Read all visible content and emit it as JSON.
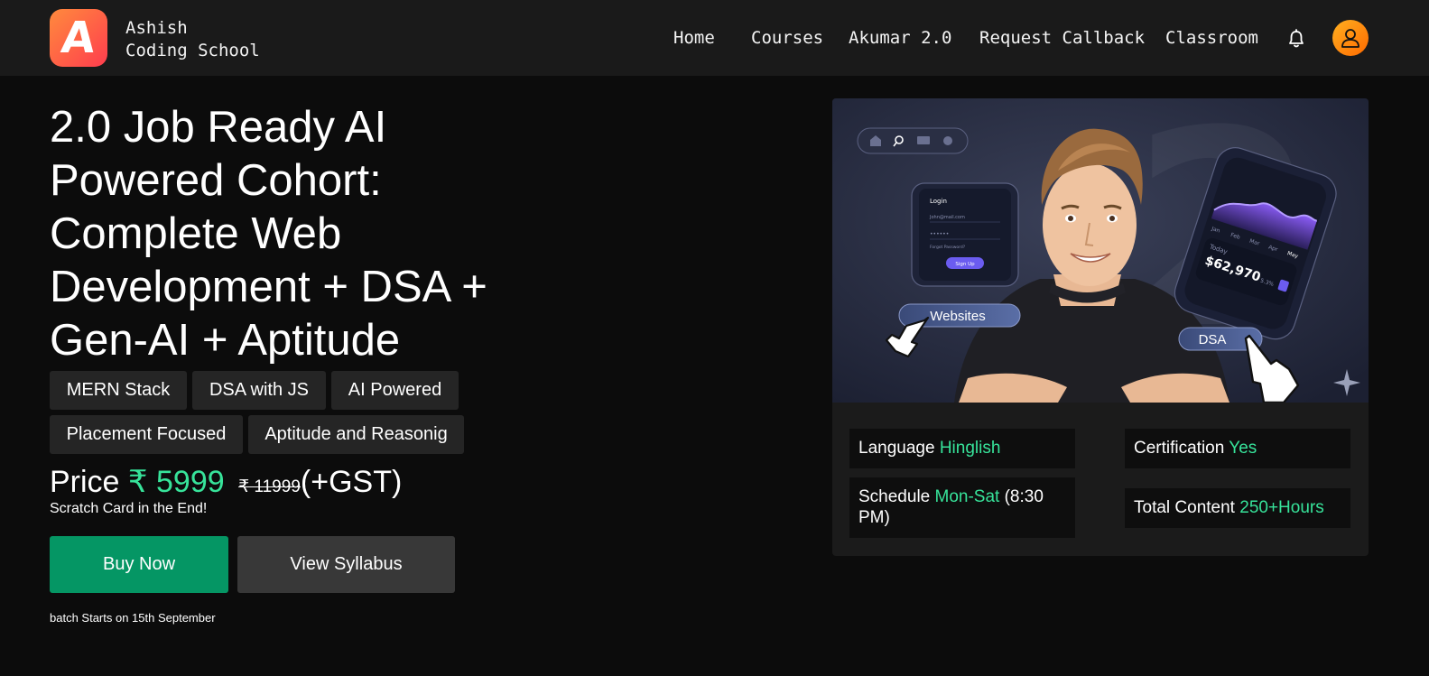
{
  "nav": {
    "logo_letter": "A",
    "brand_line1": "Ashish",
    "brand_line2": "Coding School",
    "links": [
      "Home",
      "Courses",
      "Akumar 2.0",
      "Request Callback",
      "Classroom"
    ],
    "bell_icon": "bell-icon",
    "avatar_icon": "user-icon"
  },
  "hero": {
    "title": "2.0 Job Ready AI Powered Cohort: Complete Web Development + DSA + Gen-AI + Aptitude",
    "tags": [
      "MERN Stack",
      "DSA with JS",
      "AI Powered",
      "Placement Focused",
      "Aptitude and Reasonig"
    ],
    "price_label": "Price",
    "price_now": "₹ 5999",
    "price_old": "₹ 11999",
    "price_gst": "(+GST)",
    "scratch_note": "Scratch Card in the End!",
    "buy_label": "Buy Now",
    "syllabus_label": "View Syllabus",
    "batch_note": "batch Starts on 15th September"
  },
  "banner": {
    "login_title": "Login",
    "login_email_placeholder": "John@mail.com",
    "login_password_mask": "••••••",
    "login_forgot": "Forgot Password?",
    "login_button": "Sign Up",
    "websites_label": "Websites",
    "dsa_label": "DSA",
    "dash_months": [
      "Jan",
      "Feb",
      "Mar",
      "Apr",
      "May"
    ],
    "dash_today": "Today",
    "dash_amount": "$62,970",
    "dash_percent": "5.3%"
  },
  "details": {
    "language_label": "Language",
    "language_value": "Hinglish",
    "certification_label": "Certification",
    "certification_value": "Yes",
    "schedule_label": "Schedule",
    "schedule_value": "Mon-Sat",
    "schedule_extra": "(8:30 PM)",
    "content_label": "Total Content",
    "content_value": "250+Hours"
  },
  "colors": {
    "accent_green": "#37e39a",
    "buy_button": "#059664",
    "logo_gradient_start": "#ff8a3d",
    "logo_gradient_end": "#ff3d4e",
    "avatar_gradient": "#ff8c00"
  }
}
